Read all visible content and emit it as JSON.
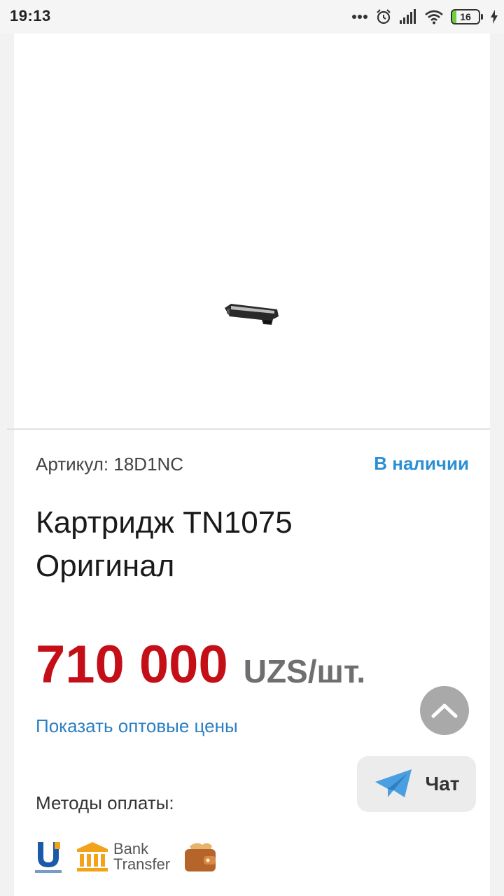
{
  "status_bar": {
    "time": "19:13",
    "battery": "16"
  },
  "product": {
    "sku": "Артикул: 18D1NC",
    "stock": "В наличии",
    "title": "Картридж TN1075 Оригинал",
    "price": "710 000",
    "price_unit": "UZS/шт.",
    "wholesale_link": "Показать оптовые цены"
  },
  "payment": {
    "label": "Методы оплаты:",
    "methods": [
      "uzcard-icon",
      "bank-transfer-icon",
      "wallet-icon"
    ],
    "bank_line1": "Bank",
    "bank_line2": "Transfer"
  },
  "chat": {
    "label": "Чат"
  },
  "colors": {
    "price": "#c40f18",
    "link": "#2b7fc2",
    "stock": "#2b8fd6",
    "bank_icon": "#f2a31b",
    "telegram": "#4a9fe0"
  }
}
